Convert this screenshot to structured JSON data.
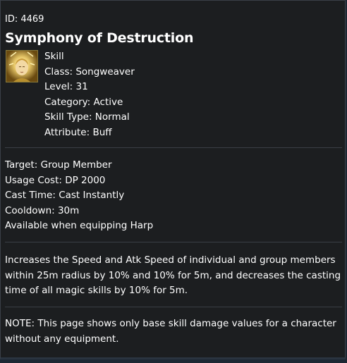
{
  "tooltip": {
    "id_line": "ID: 4469",
    "title": "Symphony of Destruction",
    "icon": "songweaver-skill-portrait-icon",
    "meta": [
      "Skill",
      "Class: Songweaver",
      "Level: 31",
      "Category: Active",
      "Skill Type: Normal",
      "Attribute: Buff"
    ],
    "details": [
      "Target: Group Member",
      "Usage Cost: DP 2000",
      "Cast Time: Cast Instantly",
      "Cooldown: 30m",
      "Available when equipping Harp"
    ],
    "description": "Increases the Speed and Atk Speed of individual and group members within 25m radius by 10% and 10% for 5m, and decreases the casting time of all magic skills by 10% for 5m.",
    "note": "NOTE: This page shows only base skill damage values for a character without any equipment."
  },
  "colors": {
    "background": "#1c1e20",
    "text": "#ffffff",
    "divider": "#3a3f46"
  }
}
